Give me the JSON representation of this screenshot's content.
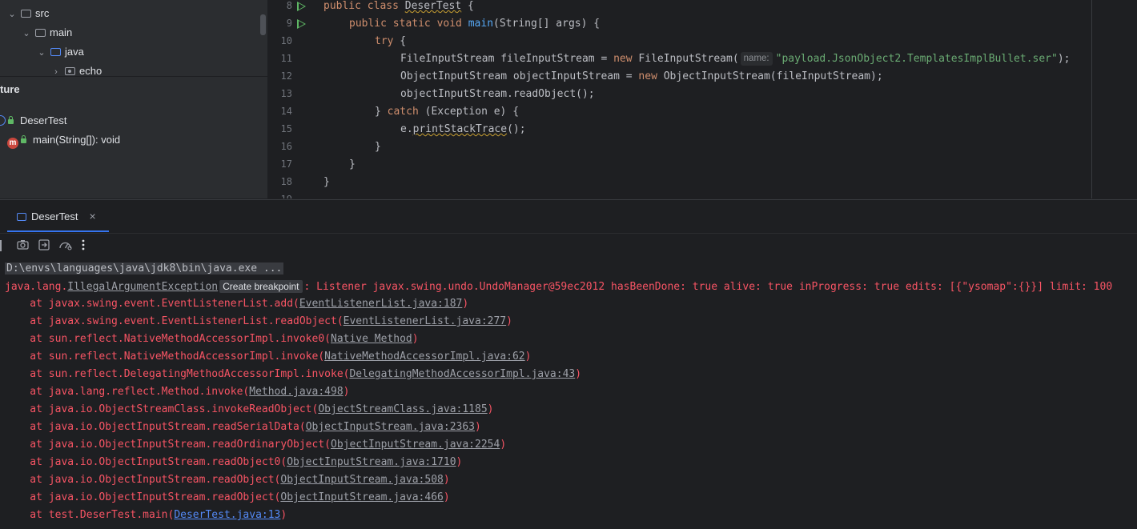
{
  "project_tree": {
    "items": [
      {
        "label": "src",
        "chevron": "⌄"
      },
      {
        "label": "main",
        "chevron": "⌄"
      },
      {
        "label": "java",
        "chevron": "⌄"
      },
      {
        "label": "echo",
        "chevron": "›"
      }
    ]
  },
  "structure": {
    "title": "ture",
    "class_name": "DeserTest",
    "method_icon_letter": "m",
    "method_label": "main(String[]): void"
  },
  "editor": {
    "lines": [
      {
        "num": "8"
      },
      {
        "num": "9"
      },
      {
        "num": "10"
      },
      {
        "num": "11"
      },
      {
        "num": "12"
      },
      {
        "num": "13"
      },
      {
        "num": "14"
      },
      {
        "num": "15"
      },
      {
        "num": "16"
      },
      {
        "num": "17"
      },
      {
        "num": "18"
      },
      {
        "num": "19"
      }
    ],
    "code": {
      "l8_kw": "public class ",
      "l8_name": "DeserTest",
      "l8_end": " {",
      "l9_kw": "public static void ",
      "l9_fn": "main",
      "l9_end": "(String[] args) {",
      "l10_kw": "try",
      "l10_end": " {",
      "l11_a": "FileInputStream fileInputStream = ",
      "l11_kw": "new",
      "l11_b": " FileInputStream(",
      "l11_hint": "name:",
      "l11_str": "\"payload.JsonObject2.TemplatesImplBullet.ser\"",
      "l11_end": ");",
      "l12_a": "ObjectInputStream objectInputStream = ",
      "l12_kw": "new",
      "l12_b": " ObjectInputStream(fileInputStream);",
      "l13": "objectInputStream.readObject();",
      "l14_a": "} ",
      "l14_kw": "catch",
      "l14_b": " (Exception e) {",
      "l15_a": "e.",
      "l15_warn": "printStackTrace",
      "l15_b": "();",
      "l16": "}",
      "l17": "}",
      "l18": "}"
    }
  },
  "run_window": {
    "tab_label": "DeserTest",
    "close_glyph": "×",
    "toolbar_icons": [
      "camera-icon",
      "exit-icon",
      "gauge-icon",
      "more-icon"
    ]
  },
  "console": {
    "command": "D:\\envs\\languages\\java\\jdk8\\bin\\java.exe ...",
    "exception_prefix": "java.lang.",
    "exception_name": "IllegalArgumentException",
    "breakpoint_label": "Create breakpoint",
    "exception_message": ": Listener javax.swing.undo.UndoManager@59ec2012 hasBeenDone: true alive: true inProgress: true edits: [{\"ysomap\":{}}] limit: 100",
    "frames": [
      {
        "at": "    at javax.swing.event.EventListenerList.add(",
        "link": "EventListenerList.java:187",
        "end": ")"
      },
      {
        "at": "    at javax.swing.event.EventListenerList.readObject(",
        "link": "EventListenerList.java:277",
        "end": ")"
      },
      {
        "at": "    at sun.reflect.NativeMethodAccessorImpl.invoke0(",
        "link": "Native Method",
        "end": ")"
      },
      {
        "at": "    at sun.reflect.NativeMethodAccessorImpl.invoke(",
        "link": "NativeMethodAccessorImpl.java:62",
        "end": ")"
      },
      {
        "at": "    at sun.reflect.DelegatingMethodAccessorImpl.invoke(",
        "link": "DelegatingMethodAccessorImpl.java:43",
        "end": ")"
      },
      {
        "at": "    at java.lang.reflect.Method.invoke(",
        "link": "Method.java:498",
        "end": ")"
      },
      {
        "at": "    at java.io.ObjectStreamClass.invokeReadObject(",
        "link": "ObjectStreamClass.java:1185",
        "end": ")"
      },
      {
        "at": "    at java.io.ObjectInputStream.readSerialData(",
        "link": "ObjectInputStream.java:2363",
        "end": ")"
      },
      {
        "at": "    at java.io.ObjectInputStream.readOrdinaryObject(",
        "link": "ObjectInputStream.java:2254",
        "end": ")"
      },
      {
        "at": "    at java.io.ObjectInputStream.readObject0(",
        "link": "ObjectInputStream.java:1710",
        "end": ")"
      },
      {
        "at": "    at java.io.ObjectInputStream.readObject(",
        "link": "ObjectInputStream.java:508",
        "end": ")"
      },
      {
        "at": "    at java.io.ObjectInputStream.readObject(",
        "link": "ObjectInputStream.java:466",
        "end": ")"
      },
      {
        "at": "    at test.DeserTest.main(",
        "link": "DeserTest.java:13",
        "end": ")"
      }
    ]
  },
  "colors": {
    "background": "#1e1f22",
    "panel": "#2b2d30",
    "error_red": "#f75464",
    "keyword": "#cf8e6d",
    "string": "#6aab73",
    "function": "#56a8f5",
    "accent_blue": "#3574f0"
  }
}
